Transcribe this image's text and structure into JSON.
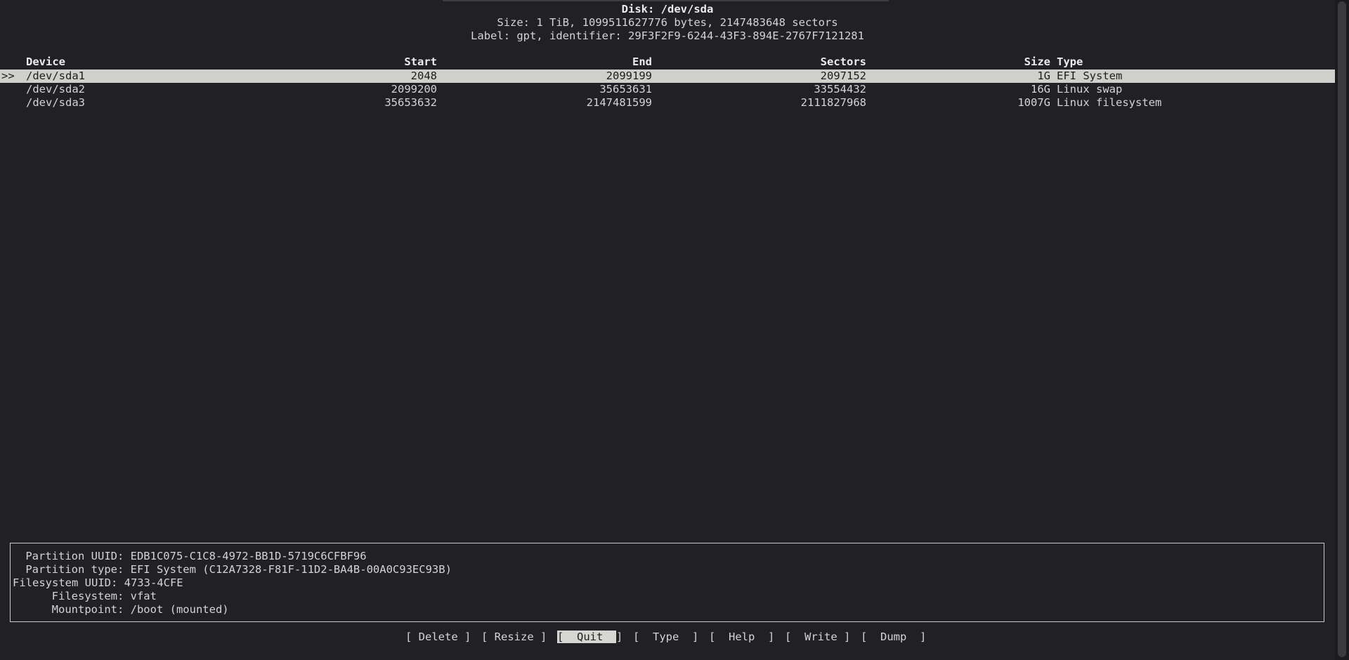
{
  "header": {
    "disk_title": "Disk: /dev/sda",
    "size_line": "Size: 1 TiB, 1099511627776 bytes, 2147483648 sectors",
    "label_line": "Label: gpt, identifier: 29F3F2F9-6244-43F3-894E-2767F7121281"
  },
  "table": {
    "columns": {
      "device": "Device",
      "start": "Start",
      "end": "End",
      "sectors": "Sectors",
      "size": "Size",
      "type": "Type"
    },
    "cursor": ">>",
    "rows": [
      {
        "device": "/dev/sda1",
        "start": "2048",
        "end": "2099199",
        "sectors": "2097152",
        "size": "1G",
        "type": "EFI System"
      },
      {
        "device": "/dev/sda2",
        "start": "2099200",
        "end": "35653631",
        "sectors": "33554432",
        "size": "16G",
        "type": "Linux swap"
      },
      {
        "device": "/dev/sda3",
        "start": "35653632",
        "end": "2147481599",
        "sectors": "2111827968",
        "size": "1007G",
        "type": "Linux filesystem"
      }
    ]
  },
  "info": {
    "partition_uuid": " Partition UUID: EDB1C075-C1C8-4972-BB1D-5719C6CFBF96",
    "partition_type": " Partition type: EFI System (C12A7328-F81F-11D2-BA4B-00A0C93EC93B)",
    "filesystem_uuid": "Filesystem UUID: 4733-4CFE",
    "filesystem": "     Filesystem: vfat",
    "mountpoint": "     Mountpoint: /boot (mounted)"
  },
  "menu": {
    "delete": "[ Delete ]",
    "resize": "[ Resize ]",
    "quit_open": "[",
    "quit_label": "  Quit  ",
    "quit_close": "]",
    "type": "[  Type  ]",
    "help": "[  Help  ]",
    "write": "[  Write ]",
    "dump": "[  Dump  ]"
  },
  "colors": {
    "background": "#212125",
    "selection": "#cfcfcb",
    "text": "#d4d4d4"
  }
}
